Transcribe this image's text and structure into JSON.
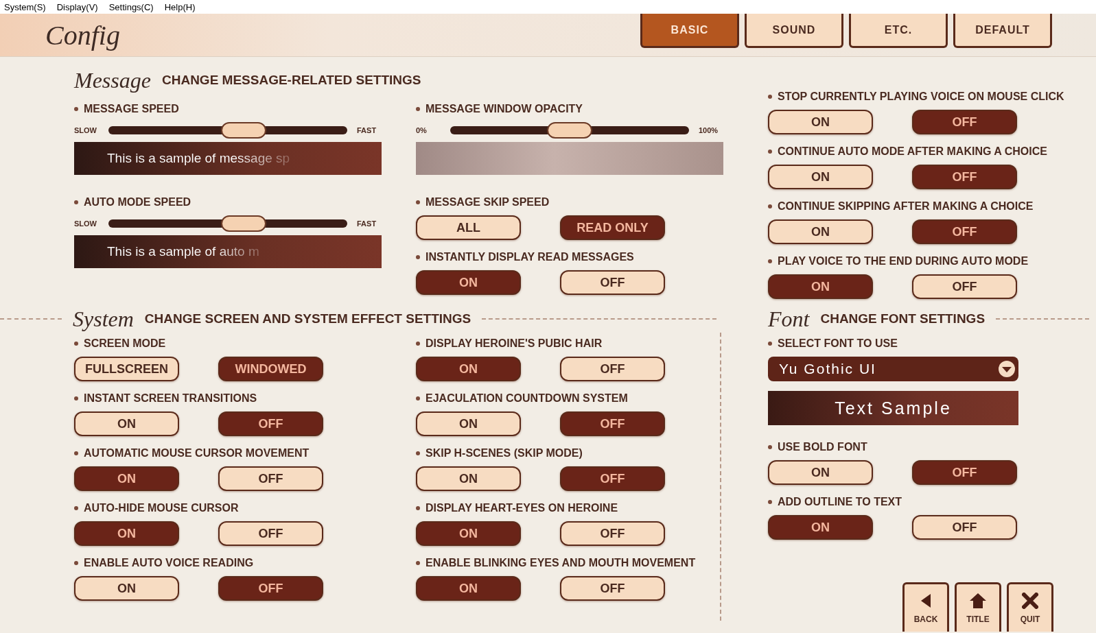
{
  "menu_bar": [
    "System(S)",
    "Display(V)",
    "Settings(C)",
    "Help(H)"
  ],
  "title": "Config",
  "tabs": [
    {
      "label": "BASIC",
      "selected": true
    },
    {
      "label": "SOUND",
      "selected": false
    },
    {
      "label": "ETC.",
      "selected": false
    },
    {
      "label": "DEFAULT",
      "selected": false
    }
  ],
  "message_heading": {
    "script": "Message",
    "text": "CHANGE MESSAGE-RELATED SETTINGS"
  },
  "upper_columns": [
    [
      {
        "kind": "slider",
        "label": "MESSAGE SPEED",
        "min_label": "SLOW",
        "max_label": "FAST",
        "level": 0.58
      },
      {
        "kind": "sample",
        "text": "This is a sample of message sp"
      },
      {
        "kind": "slider",
        "label": "AUTO MODE SPEED",
        "min_label": "SLOW",
        "max_label": "FAST",
        "level": 0.58
      },
      {
        "kind": "sample",
        "text": "This is a sample of auto m"
      }
    ],
    [
      {
        "kind": "slider",
        "label": "MESSAGE WINDOW OPACITY",
        "min_label": "0%",
        "max_label": "100%",
        "level": 0.5
      },
      {
        "kind": "preview"
      },
      {
        "kind": "toggle",
        "label": "MESSAGE SKIP SPEED",
        "options": [
          {
            "label": "ALL",
            "selected": false
          },
          {
            "label": "READ ONLY",
            "selected": true
          }
        ]
      },
      {
        "kind": "toggle",
        "label": "INSTANTLY DISPLAY READ MESSAGES",
        "options": [
          {
            "label": "ON",
            "selected": true
          },
          {
            "label": "OFF",
            "selected": false
          }
        ]
      }
    ],
    [
      {
        "kind": "toggle",
        "label": "STOP CURRENTLY PLAYING VOICE ON MOUSE CLICK",
        "options": [
          {
            "label": "ON",
            "selected": false
          },
          {
            "label": "OFF",
            "selected": true
          }
        ]
      },
      {
        "kind": "toggle",
        "label": "CONTINUE AUTO MODE AFTER MAKING A CHOICE",
        "options": [
          {
            "label": "ON",
            "selected": false
          },
          {
            "label": "OFF",
            "selected": true
          }
        ]
      },
      {
        "kind": "toggle",
        "label": "CONTINUE SKIPPING AFTER MAKING A CHOICE",
        "options": [
          {
            "label": "ON",
            "selected": false
          },
          {
            "label": "OFF",
            "selected": true
          }
        ]
      },
      {
        "kind": "toggle",
        "label": "PLAY VOICE TO THE END DURING AUTO MODE",
        "options": [
          {
            "label": "ON",
            "selected": true
          },
          {
            "label": "OFF",
            "selected": false
          }
        ]
      }
    ]
  ],
  "system_heading": {
    "script": "System",
    "text": "CHANGE SCREEN AND SYSTEM EFFECT SETTINGS"
  },
  "font_heading": {
    "script": "Font",
    "text": "CHANGE FONT SETTINGS"
  },
  "lower_columns": [
    [
      {
        "kind": "toggle",
        "label": "SCREEN MODE",
        "options": [
          {
            "label": "FULLSCREEN",
            "selected": false
          },
          {
            "label": "WINDOWED",
            "selected": true
          }
        ]
      },
      {
        "kind": "toggle",
        "label": "INSTANT SCREEN TRANSITIONS",
        "options": [
          {
            "label": "ON",
            "selected": false
          },
          {
            "label": "OFF",
            "selected": true
          }
        ]
      },
      {
        "kind": "toggle",
        "label": "AUTOMATIC MOUSE CURSOR MOVEMENT",
        "options": [
          {
            "label": "ON",
            "selected": true
          },
          {
            "label": "OFF",
            "selected": false
          }
        ]
      },
      {
        "kind": "toggle",
        "label": "AUTO-HIDE MOUSE CURSOR",
        "options": [
          {
            "label": "ON",
            "selected": true
          },
          {
            "label": "OFF",
            "selected": false
          }
        ]
      },
      {
        "kind": "toggle",
        "label": "ENABLE AUTO VOICE READING",
        "options": [
          {
            "label": "ON",
            "selected": false
          },
          {
            "label": "OFF",
            "selected": true
          }
        ]
      }
    ],
    [
      {
        "kind": "toggle",
        "label": "DISPLAY HEROINE'S PUBIC HAIR",
        "options": [
          {
            "label": "ON",
            "selected": true
          },
          {
            "label": "OFF",
            "selected": false
          }
        ]
      },
      {
        "kind": "toggle",
        "label": "EJACULATION COUNTDOWN SYSTEM",
        "options": [
          {
            "label": "ON",
            "selected": false
          },
          {
            "label": "OFF",
            "selected": true
          }
        ]
      },
      {
        "kind": "toggle",
        "label": "SKIP H-SCENES (SKIP MODE)",
        "options": [
          {
            "label": "ON",
            "selected": false
          },
          {
            "label": "OFF",
            "selected": true
          }
        ]
      },
      {
        "kind": "toggle",
        "label": "DISPLAY HEART-EYES ON HEROINE",
        "options": [
          {
            "label": "ON",
            "selected": true
          },
          {
            "label": "OFF",
            "selected": false
          }
        ]
      },
      {
        "kind": "toggle",
        "label": "ENABLE BLINKING EYES AND MOUTH MOVEMENT",
        "options": [
          {
            "label": "ON",
            "selected": true
          },
          {
            "label": "OFF",
            "selected": false
          }
        ]
      }
    ],
    [
      {
        "kind": "dropdown",
        "label": "SELECT FONT TO USE",
        "value": "Yu Gothic UI"
      },
      {
        "kind": "font_sample",
        "text": "Text Sample"
      },
      {
        "kind": "toggle",
        "label": "USE BOLD FONT",
        "options": [
          {
            "label": "ON",
            "selected": false
          },
          {
            "label": "OFF",
            "selected": true
          }
        ]
      },
      {
        "kind": "toggle",
        "label": "ADD OUTLINE TO TEXT",
        "options": [
          {
            "label": "ON",
            "selected": true
          },
          {
            "label": "OFF",
            "selected": false
          }
        ]
      }
    ]
  ],
  "nav_buttons": [
    {
      "kind": "back",
      "label": "BACK"
    },
    {
      "kind": "title",
      "label": "TITLE"
    },
    {
      "kind": "quit",
      "label": "QUIT"
    }
  ]
}
